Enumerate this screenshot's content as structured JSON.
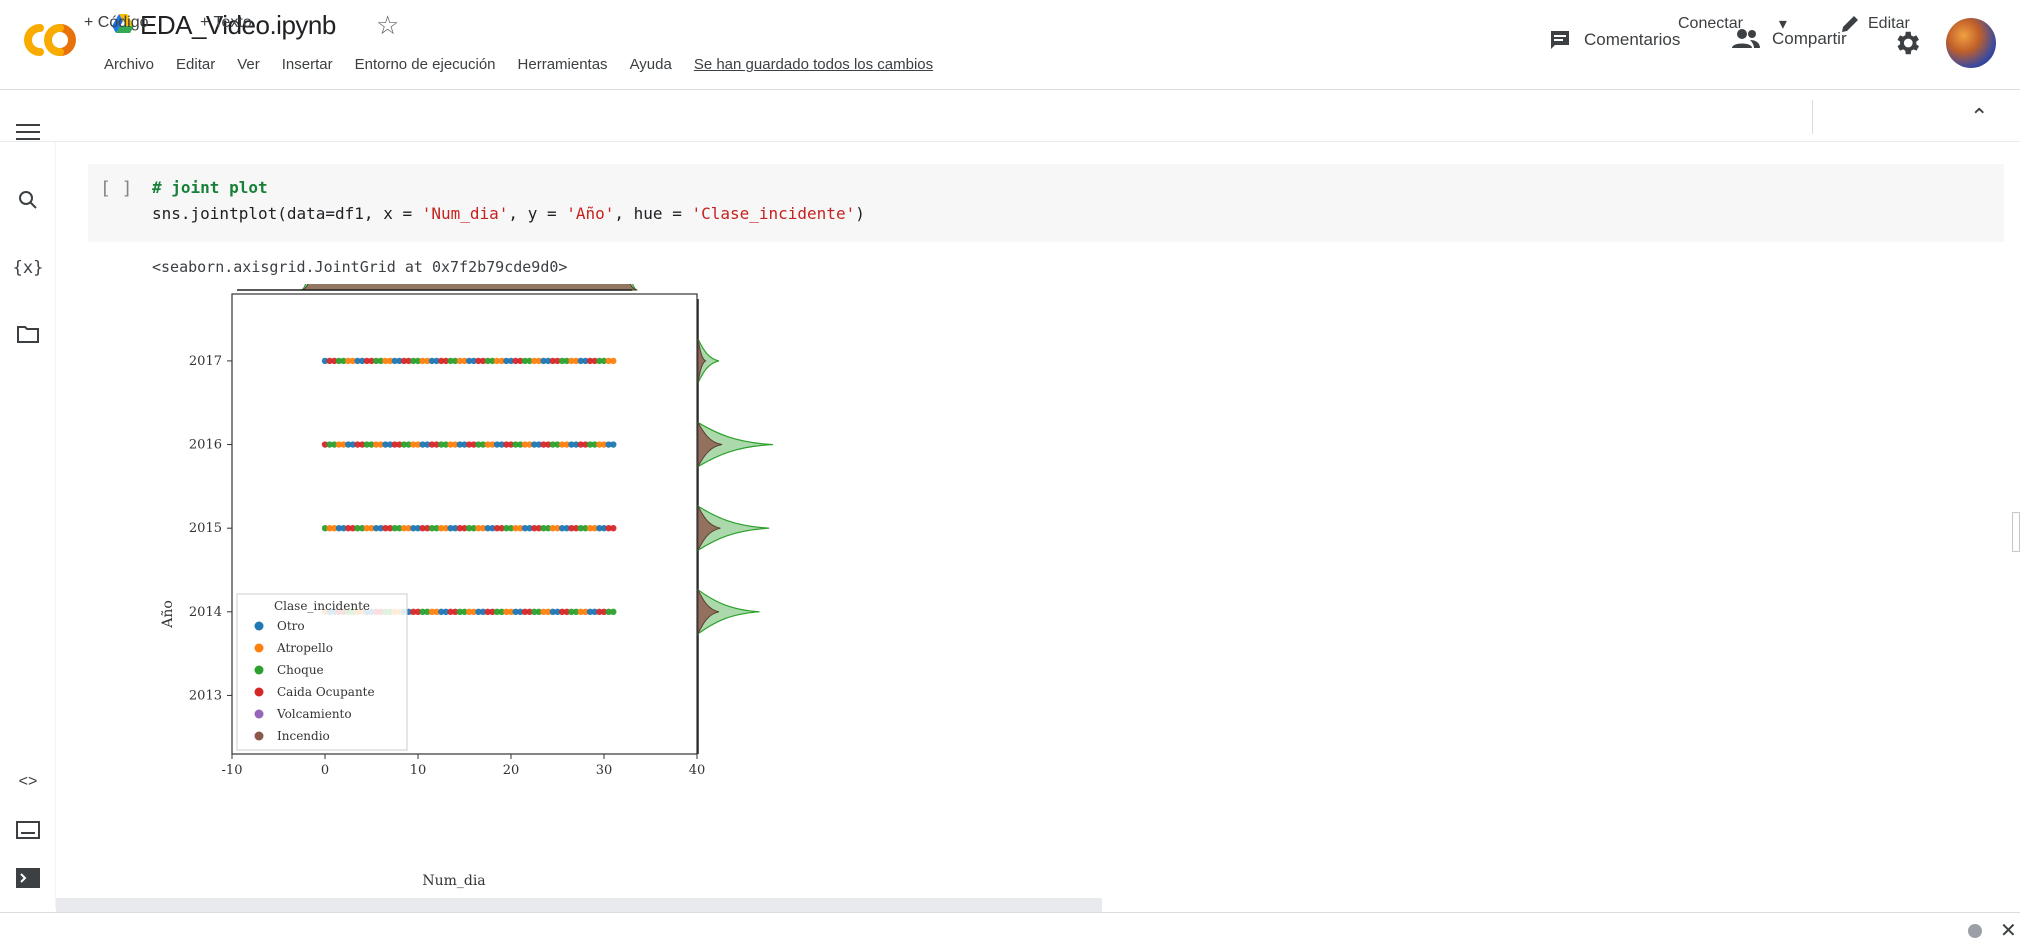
{
  "header": {
    "file_name": "EDA_Video.ipynb",
    "menu": [
      "Archivo",
      "Editar",
      "Ver",
      "Insertar",
      "Entorno de ejecución",
      "Herramientas",
      "Ayuda",
      "Se han guardado todos los cambios"
    ],
    "comments_label": "Comentarios",
    "share_label": "Compartir"
  },
  "toolbar": {
    "add_code_label": "+ Código",
    "add_text_label": "+ Texto",
    "connect_label": "Conectar",
    "edit_label": "Editar"
  },
  "cell": {
    "bracket": "[ ]",
    "comment": "# joint plot",
    "code_prefix": "sns.jointplot(data=df1, x = ",
    "code_x": "'Num_dia'",
    "code_mid1": ", y = ",
    "code_y": "'Año'",
    "code_mid2": ", hue = ",
    "code_hue": "'Clase_incidente'",
    "code_suffix": ")",
    "output_repr": "<seaborn.axisgrid.JointGrid at 0x7f2b79cde9d0>"
  },
  "chart_data": {
    "type": "scatter",
    "xlabel": "Num_dia",
    "ylabel": "Año",
    "xlim": [
      -10,
      40
    ],
    "ylim": [
      2012.3,
      2017.8
    ],
    "xticks": [
      -10,
      0,
      10,
      20,
      30,
      40
    ],
    "yticks": [
      2013,
      2014,
      2015,
      2016,
      2017
    ],
    "legend": {
      "title": "Clase_incidente",
      "position": "lower-left",
      "entries": [
        {
          "name": "Otro",
          "color": "#1f77b4"
        },
        {
          "name": "Atropello",
          "color": "#ff7f0e"
        },
        {
          "name": "Choque",
          "color": "#2ca02c"
        },
        {
          "name": "Caida Ocupante",
          "color": "#d62728"
        },
        {
          "name": "Volcamiento",
          "color": "#9467bd"
        },
        {
          "name": "Incendio",
          "color": "#8c564b"
        }
      ]
    },
    "rows": [
      {
        "year": 2017,
        "x_min": 0,
        "x_max": 31
      },
      {
        "year": 2016,
        "x_min": 0,
        "x_max": 31
      },
      {
        "year": 2015,
        "x_min": 0,
        "x_max": 31
      },
      {
        "year": 2014,
        "x_min": 0,
        "x_max": 31
      }
    ],
    "marginal_y_peaks": [
      {
        "year": 2017,
        "green": 0.28,
        "brown": 0.1
      },
      {
        "year": 2016,
        "green": 1.0,
        "brown": 0.32
      },
      {
        "year": 2015,
        "green": 0.95,
        "brown": 0.3
      },
      {
        "year": 2014,
        "green": 0.82,
        "brown": 0.28
      }
    ],
    "colors": {
      "choque": "#2ca02c",
      "incendio": "#8c564b"
    }
  }
}
